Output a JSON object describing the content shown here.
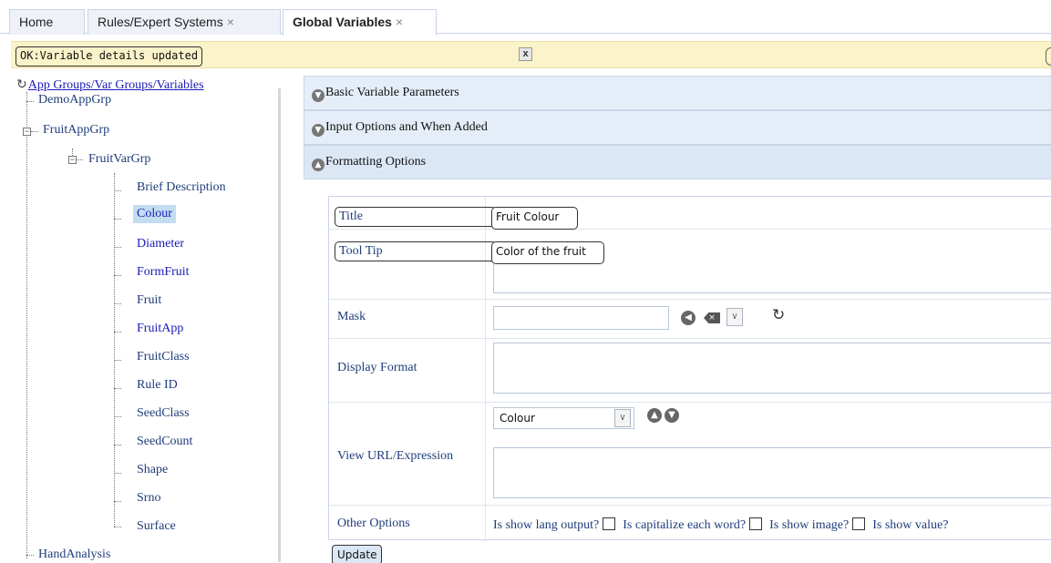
{
  "tabs": [
    {
      "label": "Home",
      "closable": false
    },
    {
      "label": "Rules/Expert Systems",
      "closable": true
    },
    {
      "label": "Global Variables",
      "closable": true,
      "active": true
    }
  ],
  "close_glyph": "×",
  "status": {
    "message": "OK:Variable details updated",
    "close_label": "x"
  },
  "tree": {
    "root_label": "App Groups/Var Groups/Variables",
    "root_icon": "refresh-icon",
    "app_groups": [
      "DemoAppGrp",
      "FruitAppGrp",
      "HandAnalysis"
    ],
    "var_group": "FruitVarGrp",
    "variables": [
      "Brief Description",
      "Colour",
      "Diameter",
      "FormFruit",
      "Fruit",
      "FruitApp",
      "FruitClass",
      "Rule ID",
      "SeedClass",
      "SeedCount",
      "Shape",
      "Srno",
      "Surface"
    ],
    "selected": "Colour"
  },
  "sections": {
    "basic": "Basic Variable Parameters",
    "input": "Input Options and When Added",
    "formatting": "Formatting Options"
  },
  "form": {
    "title_label": "Title",
    "title_value": "Fruit Colour",
    "tooltip_label": "Tool Tip",
    "tooltip_value": "Color of the fruit",
    "mask_label": "Mask",
    "mask_value": "",
    "display_format_label": "Display Format",
    "display_format_value": "",
    "view_select_value": "Colour",
    "view_url_label": "View URL/Expression",
    "view_url_value": "",
    "other_options_label": "Other Options",
    "options": [
      "Is show lang output?",
      "Is capitalize each word?",
      "Is show image?",
      "Is show value?"
    ]
  },
  "update_label": "Update",
  "colors": {
    "accordion_bg": "#e5eef8",
    "status_bg": "#fbf3c9",
    "selected_bg": "#c3ddf0",
    "link": "#1a1ab8"
  }
}
